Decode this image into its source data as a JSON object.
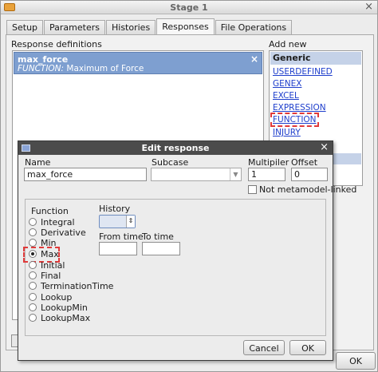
{
  "window": {
    "title": "Stage 1"
  },
  "tabs": [
    {
      "label": "Setup"
    },
    {
      "label": "Parameters"
    },
    {
      "label": "Histories"
    },
    {
      "label": "Responses"
    },
    {
      "label": "File Operations"
    }
  ],
  "responses": {
    "label": "Response definitions",
    "items": [
      {
        "name": "max_force",
        "kind": "FUNCTION:",
        "description": "Maximum of Force"
      }
    ],
    "remove_glyph": "×"
  },
  "add_new": {
    "label": "Add new",
    "header": "Generic",
    "items": [
      "USERDEFINED",
      "GENEX",
      "EXCEL",
      "EXPRESSION",
      "FUNCTION",
      "INJURY"
    ]
  },
  "main_ok": "OK",
  "dialog": {
    "title": "Edit response",
    "name_label": "Name",
    "name_value": "max_force",
    "subcase_label": "Subcase",
    "multiplier_label": "Multipiler",
    "multiplier_value": "1",
    "offset_label": "Offset",
    "offset_value": "0",
    "not_metamodel_label": "Not metamodel-linked",
    "function_label": "Function",
    "functions": [
      "Integral",
      "Derivative",
      "Min",
      "Max",
      "Initial",
      "Final",
      "TerminationTime",
      "Lookup",
      "LookupMin",
      "LookupMax"
    ],
    "selected_function": "Max",
    "history_label": "History",
    "from_time_label": "From time",
    "to_time_label": "To time",
    "cancel": "Cancel",
    "ok": "OK"
  }
}
